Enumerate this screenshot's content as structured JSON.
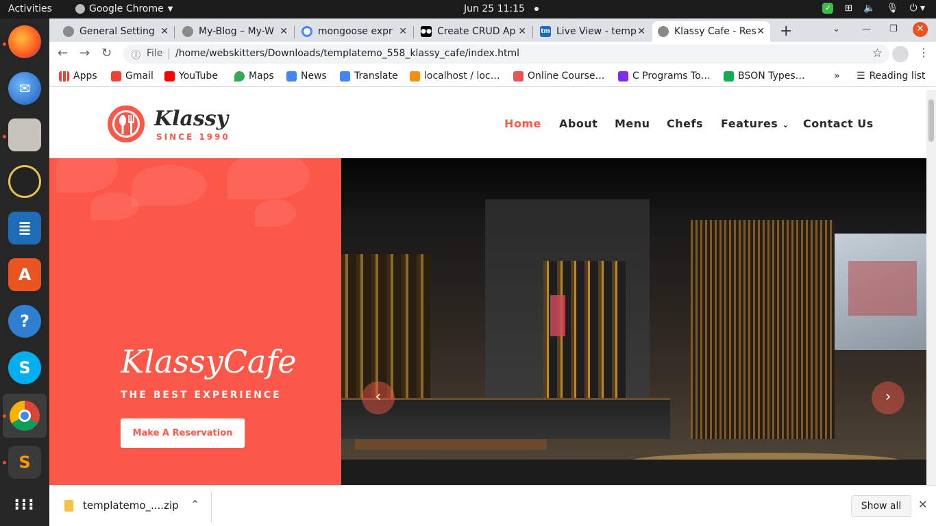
{
  "topbar": {
    "activities": "Activities",
    "app_name": "Google Chrome",
    "clock": "Jun 25  11:15"
  },
  "tabs": [
    {
      "title": "General Setting",
      "icon": "globe-icon",
      "color": "#8a8a8a"
    },
    {
      "title": "My-Blog – My-W",
      "icon": "globe-icon",
      "color": "#8a8a8a"
    },
    {
      "title": "mongoose expr",
      "icon": "google-icon",
      "color": "#4285f4"
    },
    {
      "title": "Create CRUD Ap",
      "icon": "medium-icon",
      "color": "#000000"
    },
    {
      "title": "Live View - temp",
      "icon": "tm-icon",
      "color": "#1b6bc2"
    },
    {
      "title": "Klassy Cafe - Res",
      "icon": "globe-icon",
      "color": "#8a8a8a",
      "active": true
    }
  ],
  "toolbar": {
    "scheme": "File",
    "url": "/home/webskitters/Downloads/templatemo_558_klassy_cafe/index.html"
  },
  "bookmarks": [
    {
      "label": "Apps",
      "color": "#ea4335"
    },
    {
      "label": "Gmail",
      "color": "#ea4335"
    },
    {
      "label": "YouTube",
      "color": "#ff0000"
    },
    {
      "label": "Maps",
      "color": "#34a853"
    },
    {
      "label": "News",
      "color": "#4285f4"
    },
    {
      "label": "Translate",
      "color": "#4285f4"
    },
    {
      "label": "localhost / loc…",
      "color": "#f29111"
    },
    {
      "label": "Online Course…",
      "color": "#ec5252"
    },
    {
      "label": "C Programs To…",
      "color": "#7b2cf0"
    },
    {
      "label": "BSON Types…",
      "color": "#13aa52"
    }
  ],
  "bookmarks_more": "»",
  "reading_list": "Reading list",
  "site": {
    "logo_name": "Klassy",
    "logo_since": "SINCE 1990",
    "nav": [
      "Home",
      "About",
      "Menu",
      "Chefs",
      "Features",
      "Contact Us"
    ],
    "features_caret": "⌄",
    "hero_title": "KlassyCafe",
    "hero_subtitle": "THE BEST EXPERIENCE",
    "hero_button": "Make A Reservation",
    "accent": "#fb5849"
  },
  "download": {
    "file": "templatemo_....zip",
    "show_all": "Show all"
  }
}
